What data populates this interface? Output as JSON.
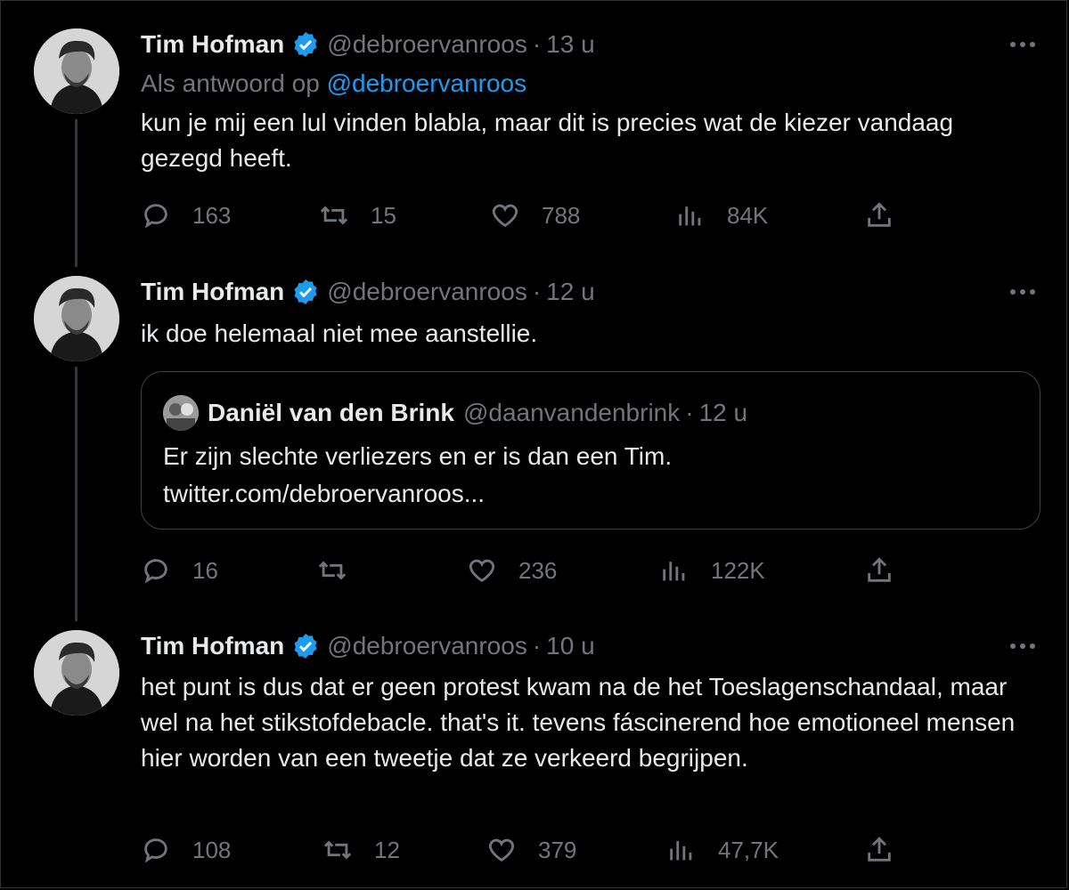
{
  "tweets": [
    {
      "name": "Tim Hofman",
      "handle": "@debroervanroos",
      "dot": "·",
      "time": "13 u",
      "reply_prefix": "Als antwoord op",
      "reply_mention": "@debroervanroos",
      "text": "kun je mij een lul vinden blabla, maar dit is precies wat de kiezer vandaag gezegd heeft.",
      "replies": "163",
      "retweets": "15",
      "likes": "788",
      "views": "84K"
    },
    {
      "name": "Tim Hofman",
      "handle": "@debroervanroos",
      "dot": "·",
      "time": "12 u",
      "text": "ik doe helemaal niet mee aanstellie.",
      "quote": {
        "name": "Daniël van den Brink",
        "handle": "@daanvandenbrink",
        "dot": "·",
        "time": "12 u",
        "line1": "Er zijn slechte verliezers en er is dan een Tim.",
        "line2": "twitter.com/debroervanroos..."
      },
      "replies": "16",
      "retweets": "",
      "likes": "236",
      "views": "122K"
    },
    {
      "name": "Tim Hofman",
      "handle": "@debroervanroos",
      "dot": "·",
      "time": "10 u",
      "text": "het punt is dus dat er geen protest kwam na de het Toeslagenschandaal, maar wel na het stikstofdebacle. that's it. tevens fáscinerend hoe emotioneel mensen hier worden van een tweetje dat ze verkeerd begrijpen.",
      "replies": "108",
      "retweets": "12",
      "likes": "379",
      "views": "47,7K"
    }
  ],
  "colors": {
    "background": "#000000",
    "text": "#e7e9ea",
    "muted": "#71767b",
    "link": "#1d9bf0",
    "verified": "#1d9bf0"
  },
  "icons": [
    "reply-icon",
    "retweet-icon",
    "like-icon",
    "views-icon",
    "share-icon",
    "verified-badge-icon",
    "more-icon"
  ]
}
